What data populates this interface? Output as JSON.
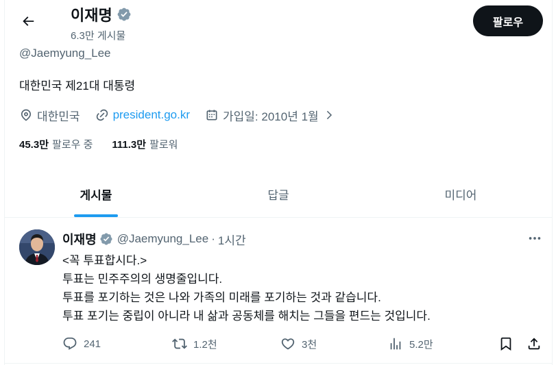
{
  "header": {
    "name": "이재명",
    "post_count": "6.3만 게시물",
    "follow_label": "팔로우"
  },
  "profile": {
    "handle": "@Jaemyung_Lee",
    "bio": "대한민국 제21대 대통령",
    "location": "대한민국",
    "website": "president.go.kr",
    "joined": "가입일: 2010년 1월",
    "following_count": "45.3만",
    "following_label": "팔로우 중",
    "followers_count": "111.3만",
    "followers_label": "팔로워"
  },
  "tabs": [
    {
      "label": "게시물",
      "active": true
    },
    {
      "label": "답글",
      "active": false
    },
    {
      "label": "미디어",
      "active": false
    }
  ],
  "tweet": {
    "name": "이재명",
    "handle": "@Jaemyung_Lee",
    "separator": "·",
    "time": "1시간",
    "lines": [
      "<꼭 투표합시다.>",
      "투표는 민주주의의 생명줄입니다.",
      "투표를 포기하는 것은 나와 가족의 미래를 포기하는 것과 같습니다.",
      "투표 포기는 중립이 아니라 내 삶과 공동체를 해치는 그들을 편드는 것입니다."
    ],
    "replies": "241",
    "retweets": "1.2천",
    "likes": "3천",
    "views": "5.2만"
  },
  "colors": {
    "accent": "#1d9bf0",
    "text_primary": "#0f1419",
    "text_secondary": "#536471",
    "follow_button_bg": "#0f1419"
  },
  "icons": [
    "back-arrow-icon",
    "verified-badge-icon",
    "location-icon",
    "link-icon",
    "calendar-icon",
    "chevron-right-icon",
    "more-icon",
    "reply-icon",
    "retweet-icon",
    "like-icon",
    "views-icon",
    "bookmark-icon",
    "share-icon"
  ]
}
